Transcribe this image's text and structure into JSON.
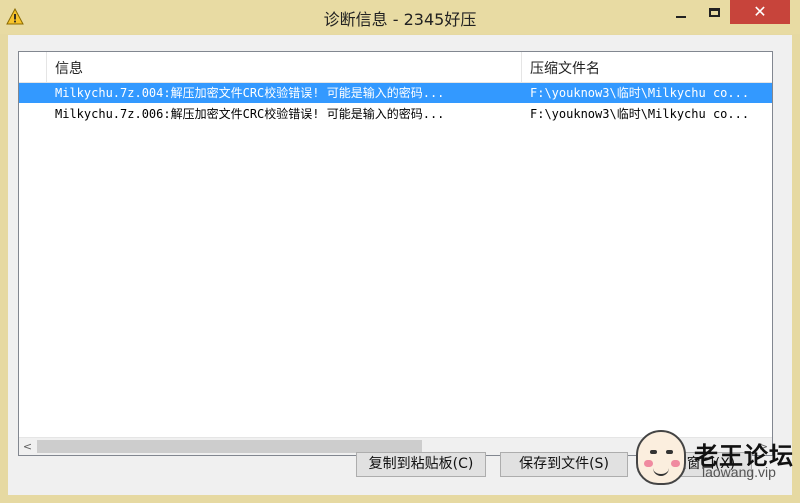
{
  "window": {
    "title": "诊断信息 - 2345好压",
    "icons": {
      "app": "warning-icon",
      "minimize": "minimize-icon",
      "maximize": "maximize-icon",
      "close": "close-icon"
    },
    "close_glyph": "✕"
  },
  "list": {
    "columns": [
      "",
      "信息",
      "压缩文件名"
    ],
    "rows": [
      {
        "info": "Milkychu.7z.004:解压加密文件CRC校验错误! 可能是输入的密码...",
        "file": "F:\\youknow3\\临时\\Milkychu co...",
        "selected": true
      },
      {
        "info": "Milkychu.7z.006:解压加密文件CRC校验错误! 可能是输入的密码...",
        "file": "F:\\youknow3\\临时\\Milkychu co...",
        "selected": false
      }
    ],
    "scrollbar": {
      "left_arrow": "<",
      "right_arrow": ">"
    }
  },
  "buttons": {
    "copy": "复制到粘贴板(C)",
    "save": "保存到文件(S)",
    "close": "关闭窗口(X)"
  },
  "watermark": {
    "title": "老王论坛",
    "url": "laowang.vip"
  },
  "colors": {
    "titlebar": "#e8dba3",
    "close_button": "#c7443b",
    "selection": "#3399ff"
  }
}
